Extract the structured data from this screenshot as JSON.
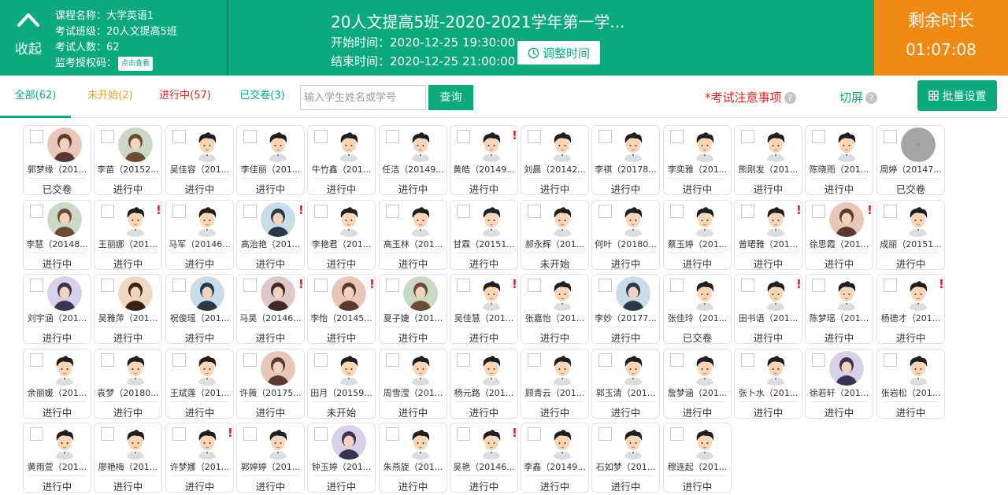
{
  "header": {
    "collapse_label": "收起",
    "course_name": "课程名称：大学英语1",
    "exam_class": "考试班级：20人文提高5班",
    "exam_count": "考试人数：62",
    "proctor_code_label": "监考授权码：",
    "proctor_code_button": "点击查看",
    "exam_title": "20人文提高5班-2020-2021学年第一学...",
    "start_time": "开始时间：2020-12-25 19:30:00",
    "end_time": "结束时间：2020-12-25 21:00:00",
    "adjust_button": "调整时间",
    "remaining_label": "剩余时长",
    "remaining_time": "01:07:08"
  },
  "filters": {
    "all": "全部(62)",
    "not_started": "未开始(2)",
    "in_progress": "进行中(57)",
    "submitted": "已交卷(3)",
    "search_placeholder": "输入学生姓名或学号",
    "search_button": "查询",
    "notice": "*考试注意事项",
    "switch_screen": "切屏",
    "batch_settings": "批量设置"
  },
  "colors": {
    "primary": "#0aaa7d",
    "orange": "#f08a12",
    "alert": "#e02020",
    "pending": "#f0a020"
  },
  "students": [
    {
      "name": "郭梦缘（201...",
      "status": "已交卷",
      "avatar": "photo",
      "alert": false
    },
    {
      "name": "李苗（20152...",
      "status": "进行中",
      "avatar": "photo",
      "alert": false
    },
    {
      "name": "吴佳容（201...",
      "status": "进行中",
      "avatar": "default",
      "alert": false
    },
    {
      "name": "李佳丽（201...",
      "status": "进行中",
      "avatar": "default",
      "alert": false
    },
    {
      "name": "牛竹鑫（201...",
      "status": "进行中",
      "avatar": "default",
      "alert": false
    },
    {
      "name": "任洁（20149...",
      "status": "进行中",
      "avatar": "default",
      "alert": false
    },
    {
      "name": "黄皓（20149...",
      "status": "进行中",
      "avatar": "default",
      "alert": true
    },
    {
      "name": "刘晨（20142...",
      "status": "进行中",
      "avatar": "default",
      "alert": false
    },
    {
      "name": "李祺（20178...",
      "status": "进行中",
      "avatar": "default",
      "alert": false
    },
    {
      "name": "李奕雅（201...",
      "status": "进行中",
      "avatar": "default",
      "alert": false
    },
    {
      "name": "熊刚发（201...",
      "status": "进行中",
      "avatar": "default",
      "alert": false
    },
    {
      "name": "陈晓雨（201...",
      "status": "进行中",
      "avatar": "default",
      "alert": false
    },
    {
      "name": "周婷（20147...",
      "status": "已交卷",
      "avatar": "gray",
      "alert": false
    },
    {
      "name": "李慧（20148...",
      "status": "进行中",
      "avatar": "photo",
      "alert": false
    },
    {
      "name": "王丽娜（201...",
      "status": "进行中",
      "avatar": "default",
      "alert": true
    },
    {
      "name": "马军（20146...",
      "status": "进行中",
      "avatar": "default",
      "alert": false
    },
    {
      "name": "高治艳（201...",
      "status": "进行中",
      "avatar": "photo",
      "alert": true
    },
    {
      "name": "李艳君（201...",
      "status": "进行中",
      "avatar": "default",
      "alert": false
    },
    {
      "name": "高玉林（201...",
      "status": "进行中",
      "avatar": "default",
      "alert": false
    },
    {
      "name": "甘霖（20151...",
      "status": "进行中",
      "avatar": "default",
      "alert": false
    },
    {
      "name": "郝永辉（201...",
      "status": "未开始",
      "avatar": "default",
      "alert": false
    },
    {
      "name": "何叶（20180...",
      "status": "进行中",
      "avatar": "default",
      "alert": false
    },
    {
      "name": "蔡玉婷（201...",
      "status": "进行中",
      "avatar": "default",
      "alert": false
    },
    {
      "name": "曾珺雅（201...",
      "status": "进行中",
      "avatar": "default",
      "alert": true
    },
    {
      "name": "徐思霞（201...",
      "status": "进行中",
      "avatar": "photo",
      "alert": true
    },
    {
      "name": "成丽（20151...",
      "status": "进行中",
      "avatar": "default",
      "alert": false
    },
    {
      "name": "刘宇涵（201...",
      "status": "进行中",
      "avatar": "photo",
      "alert": false
    },
    {
      "name": "吴雅萍（201...",
      "status": "进行中",
      "avatar": "photo",
      "alert": false
    },
    {
      "name": "祝俊瑶（201...",
      "status": "进行中",
      "avatar": "photo",
      "alert": false
    },
    {
      "name": "马昊（20146...",
      "status": "进行中",
      "avatar": "photo",
      "alert": true
    },
    {
      "name": "李怡（20145...",
      "status": "进行中",
      "avatar": "photo",
      "alert": true
    },
    {
      "name": "夏子婕（201...",
      "status": "进行中",
      "avatar": "photo",
      "alert": false
    },
    {
      "name": "吴佳慧（201...",
      "status": "进行中",
      "avatar": "default",
      "alert": true
    },
    {
      "name": "张嘉怡（201...",
      "status": "进行中",
      "avatar": "default",
      "alert": false
    },
    {
      "name": "李妙（20177...",
      "status": "进行中",
      "avatar": "photo",
      "alert": false
    },
    {
      "name": "张佳玲（201...",
      "status": "已交卷",
      "avatar": "default",
      "alert": false
    },
    {
      "name": "田书语（201...",
      "status": "进行中",
      "avatar": "default",
      "alert": true
    },
    {
      "name": "陈梦瑶（201...",
      "status": "进行中",
      "avatar": "default",
      "alert": false
    },
    {
      "name": "杨德才（201...",
      "status": "进行中",
      "avatar": "default",
      "alert": true
    },
    {
      "name": "余丽媛（201...",
      "status": "进行中",
      "avatar": "default",
      "alert": false
    },
    {
      "name": "袁梦（20180...",
      "status": "进行中",
      "avatar": "default",
      "alert": false
    },
    {
      "name": "王斌莲（201...",
      "status": "进行中",
      "avatar": "default",
      "alert": false
    },
    {
      "name": "许薇（20175...",
      "status": "进行中",
      "avatar": "photo",
      "alert": false
    },
    {
      "name": "田月（20159...",
      "status": "未开始",
      "avatar": "default",
      "alert": false
    },
    {
      "name": "周雪滢（201...",
      "status": "进行中",
      "avatar": "default",
      "alert": false
    },
    {
      "name": "杨元路（201...",
      "status": "进行中",
      "avatar": "default",
      "alert": false
    },
    {
      "name": "顾青云（201...",
      "status": "进行中",
      "avatar": "default",
      "alert": false
    },
    {
      "name": "郭玉清（201...",
      "status": "进行中",
      "avatar": "default",
      "alert": false
    },
    {
      "name": "詹梦涵（201...",
      "status": "进行中",
      "avatar": "default",
      "alert": false
    },
    {
      "name": "张卜水（201...",
      "status": "进行中",
      "avatar": "default",
      "alert": false
    },
    {
      "name": "徐若轩（201...",
      "status": "进行中",
      "avatar": "photo",
      "alert": false
    },
    {
      "name": "张岩松（201...",
      "status": "进行中",
      "avatar": "default",
      "alert": false
    },
    {
      "name": "黄雨萱（201...",
      "status": "进行中",
      "avatar": "default",
      "alert": false
    },
    {
      "name": "廖艳梅（201...",
      "status": "进行中",
      "avatar": "default",
      "alert": false
    },
    {
      "name": "许梦娜（201...",
      "status": "进行中",
      "avatar": "default",
      "alert": true
    },
    {
      "name": "郭婷婷（201...",
      "status": "进行中",
      "avatar": "default",
      "alert": false
    },
    {
      "name": "钟玉婷（201...",
      "status": "进行中",
      "avatar": "photo",
      "alert": false
    },
    {
      "name": "朱燕旋（201...",
      "status": "进行中",
      "avatar": "default",
      "alert": false
    },
    {
      "name": "吴艳（20146...",
      "status": "进行中",
      "avatar": "default",
      "alert": true
    },
    {
      "name": "李鑫（20149...",
      "status": "进行中",
      "avatar": "default",
      "alert": false
    },
    {
      "name": "石如梦（201...",
      "status": "进行中",
      "avatar": "default",
      "alert": false
    },
    {
      "name": "穆连起（201...",
      "status": "进行中",
      "avatar": "default",
      "alert": false
    }
  ]
}
